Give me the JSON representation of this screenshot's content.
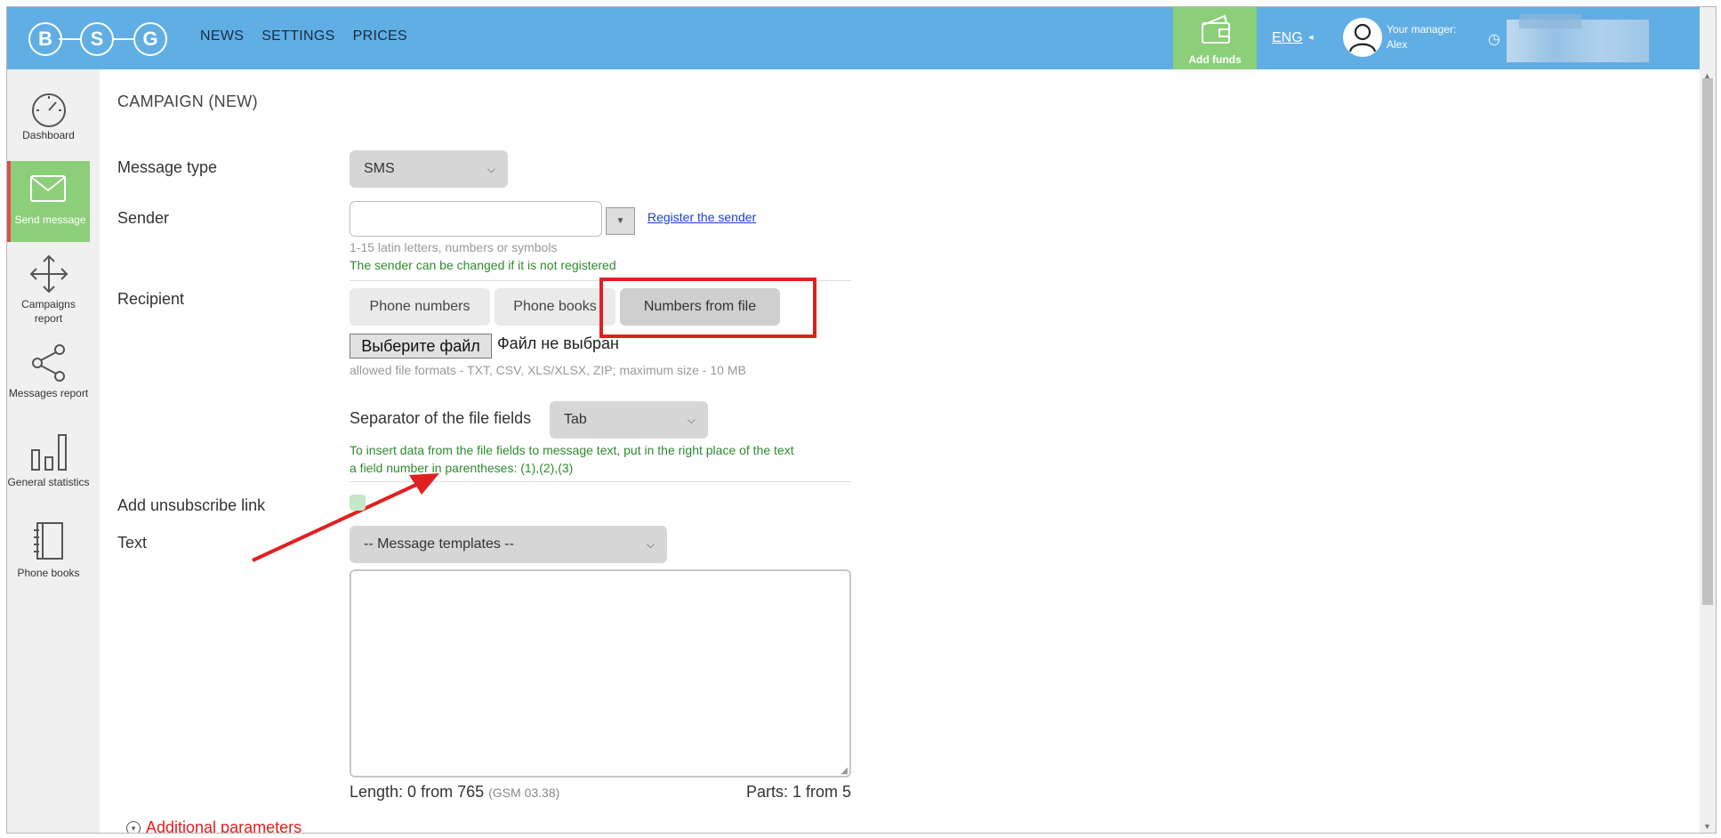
{
  "header": {
    "logo_letters": [
      "B",
      "S",
      "G"
    ],
    "nav": [
      "NEWS",
      "SETTINGS",
      "PRICES"
    ],
    "add_funds": "Add funds",
    "lang": "ENG",
    "manager_label": "Your manager:",
    "manager_name": "Alex"
  },
  "sidebar": {
    "items": [
      {
        "label": "Dashboard",
        "icon": "gauge-icon"
      },
      {
        "label": "Send message",
        "icon": "envelope-icon",
        "active": true
      },
      {
        "label": "Campaigns report",
        "icon": "move-arrows-icon"
      },
      {
        "label": "Messages report",
        "icon": "share-icon"
      },
      {
        "label": "General statistics",
        "icon": "bar-chart-icon"
      },
      {
        "label": "Phone books",
        "icon": "notebook-icon"
      }
    ]
  },
  "form": {
    "title": "CAMPAIGN (NEW)",
    "message_type_label": "Message type",
    "message_type_value": "SMS",
    "sender_label": "Sender",
    "sender_value": "",
    "register_sender": "Register the sender",
    "sender_hint": "1-15 latin letters, numbers or symbols",
    "sender_note": "The sender can be changed if it is not registered",
    "recipient_label": "Recipient",
    "recipient_tabs": [
      "Phone numbers",
      "Phone books",
      "Numbers from file"
    ],
    "active_tab": "Numbers from file",
    "file_button": "Выберите файл",
    "file_none": "Файл не выбран",
    "file_hint": "allowed file formats - TXT, CSV, XLS/XLSX, ZIP; maximum size - 10 MB",
    "separator_label": "Separator of the file fields",
    "separator_value": "Tab",
    "insert_hint_1": "To insert data from the file fields to message text, put in the right place of the text",
    "insert_hint_2": "a field number in parentheses: (1),(2),(3)",
    "unsubscribe_label": "Add unsubscribe link",
    "text_label": "Text",
    "templates_value": "-- Message templates --",
    "length_text": "Length: 0 from 765",
    "length_encoding": "(GSM 03.38)",
    "parts_text": "Parts: 1 from 5",
    "additional_parameters": "Additional parameters"
  },
  "colors": {
    "header_bg": "#61aee5",
    "accent_green": "#8ccf79",
    "highlight_red": "#e02020",
    "hint_green": "#2e8a2e"
  }
}
